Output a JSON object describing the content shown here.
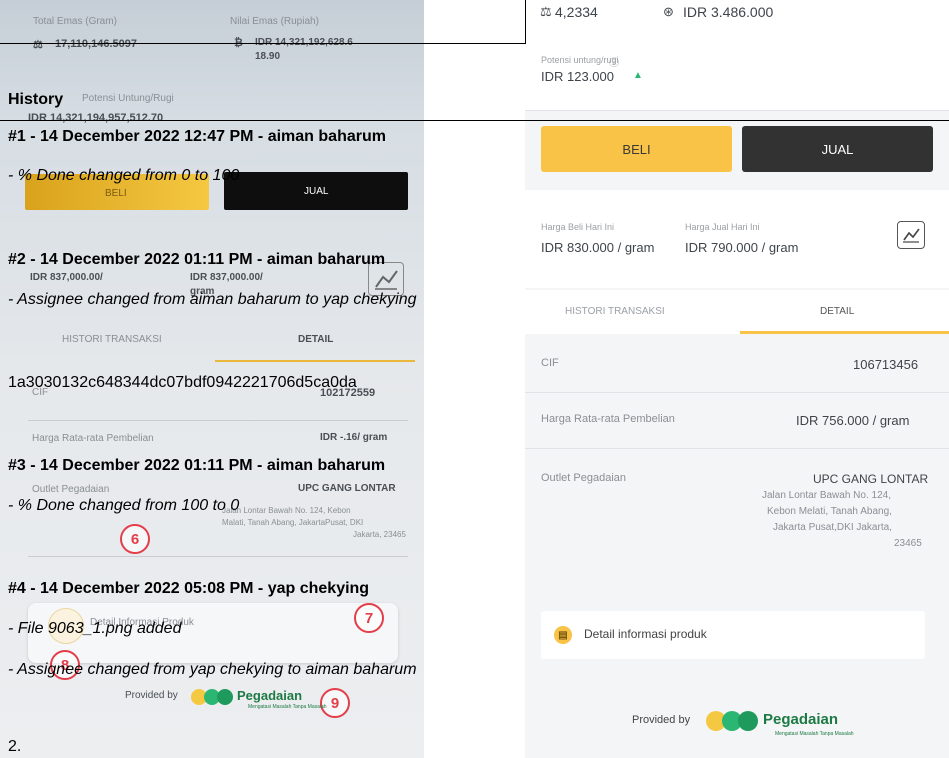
{
  "left_screen": {
    "total_emas_label": "Total Emas (Gram)",
    "total_emas_value": "17,110,146.5097",
    "nilai_emas_label": "Nilai Emas (Rupiah)",
    "nilai_emas_value_line1": "IDR 14,321,192,628.6",
    "nilai_emas_value_line2": "18.90",
    "potensi_label": "Potensi Untung/Rugi",
    "potensi_value": "IDR 14,321,194,957,512.70",
    "beli_label": "BELI",
    "jual_label": "JUAL",
    "harga_beli_value_line1": "IDR 837,000.00/",
    "harga_jual_value_line1": "IDR 837,000.00/",
    "harga_jual_value_line2": "gram",
    "tab_histori": "HISTORI TRANSAKSI",
    "tab_detail": "DETAIL",
    "cif_label": "CIF",
    "cif_value": "102172559",
    "harga_rata_label": "Harga Rata-rata Pembelian",
    "harga_rata_value": "IDR -.16/ gram",
    "outlet_label": "Outlet Pegadaian",
    "outlet_name": "UPC GANG LONTAR",
    "outlet_address_1": "Jalan Lontar Bawah No. 124, Kebon",
    "outlet_address_2": "Malati, Tanah Abang, JakartaPusat, DKI",
    "outlet_address_3": "Jakarta, 23465",
    "detail_info_label": "Detail Informasi Produk",
    "provided_by": "Provided by",
    "brand": "Pegadaian",
    "brand_tagline": "Mengatasi Masalah Tanpa Masalah",
    "badges": [
      "6",
      "7",
      "8",
      "9"
    ]
  },
  "right_screen": {
    "gram_value": "4,2334",
    "rupiah_value": "IDR 3.486.000",
    "potensi_label": "Potensi untung/rugi",
    "potensi_value": "IDR 123.000",
    "beli_label": "BELI",
    "jual_label": "JUAL",
    "harga_beli_label": "Harga Beli Hari Ini",
    "harga_beli_value": "IDR 830.000 / gram",
    "harga_jual_label": "Harga Jual Hari Ini",
    "harga_jual_value": "IDR 790.000 / gram",
    "tab_histori": "HISTORI TRANSAKSI",
    "tab_detail": "DETAIL",
    "cif_label": "CIF",
    "cif_value": "106713456",
    "harga_rata_label": "Harga Rata-rata Pembelian",
    "harga_rata_value": "IDR 756.000 / gram",
    "outlet_label": "Outlet Pegadaian",
    "outlet_name": "UPC GANG LONTAR",
    "outlet_address_1": "Jalan Lontar Bawah No. 124,",
    "outlet_address_2": "Kebon Melati, Tanah Abang,",
    "outlet_address_3": "Jakarta Pusat,DKI Jakarta,",
    "outlet_address_4": "23465",
    "detail_info_label": "Detail informasi produk",
    "provided_by": "Provided by",
    "brand": "Pegadaian",
    "brand_tagline": "Mengatasi Masalah Tanpa Masalah"
  },
  "history": {
    "title": "History",
    "entries": [
      {
        "header": "#1 - 14 December 2022 12:47 PM - aiman baharum",
        "changes": [
          "- % Done changed from 0 to 100"
        ]
      },
      {
        "header": "#2 - 14 December 2022 01:11 PM - aiman baharum",
        "changes": [
          "- Assignee changed from aiman baharum to yap chekying"
        ]
      },
      {
        "header": "#3 - 14 December 2022 01:11 PM - aiman baharum",
        "changes": [
          "- % Done changed from 100 to 0"
        ]
      },
      {
        "header": "#4 - 14 December 2022 05:08 PM - yap chekying",
        "changes": [
          "- File 9063_1.png added",
          "- Assignee changed from yap chekying to aiman baharum"
        ]
      }
    ],
    "hash": "1a3030132c648344dc07bdf0942221706d5ca0da",
    "footer": "2."
  },
  "colors": {
    "gold": "#f8c346",
    "dark_button": "#323232",
    "badge_red": "#e33e4a",
    "up_arrow_green": "#2bb673"
  }
}
